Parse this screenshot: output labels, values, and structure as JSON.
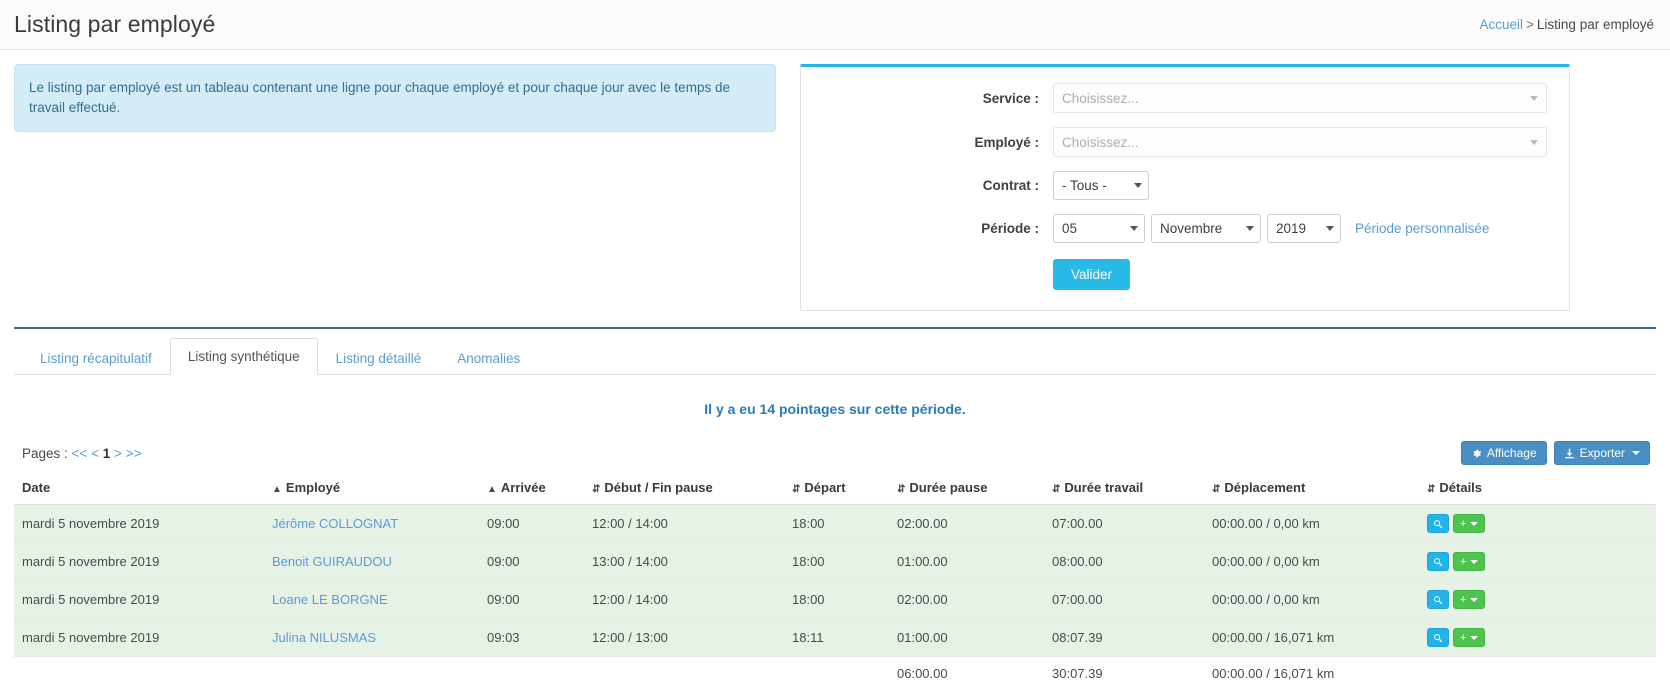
{
  "header": {
    "title": "Listing par employé",
    "breadcrumb_home": "Accueil",
    "breadcrumb_sep": ">",
    "breadcrumb_current": "Listing par employé"
  },
  "alert": {
    "text": "Le listing par employé est un tableau contenant une ligne pour chaque employé et pour chaque jour avec le temps de travail effectué."
  },
  "filters": {
    "service_label": "Service :",
    "service_placeholder": "Choisissez...",
    "service_value": "",
    "employe_label": "Employé :",
    "employe_placeholder": "Choisissez...",
    "employe_value": "",
    "contrat_label": "Contrat :",
    "contrat_value": "- Tous -",
    "periode_label": "Période :",
    "periode_day": "05",
    "periode_month": "Novembre",
    "periode_year": "2019",
    "periode_custom_link": "Période personnalisée",
    "submit_label": "Valider"
  },
  "tabs": [
    {
      "label": "Listing récapitulatif",
      "active": false
    },
    {
      "label": "Listing synthétique",
      "active": true
    },
    {
      "label": "Listing détaillé",
      "active": false
    },
    {
      "label": "Anomalies",
      "active": false
    }
  ],
  "summary": {
    "count_text": "Il y a eu 14 pointages sur cette période."
  },
  "toolbar": {
    "pages_label": "Pages :",
    "first": "<<",
    "prev": "<",
    "current": "1",
    "next": ">",
    "last": ">>",
    "affichage_label": "Affichage",
    "exporter_label": "Exporter",
    "gear_icon": "gear-icon",
    "download_icon": "download-icon"
  },
  "table": {
    "columns": [
      {
        "label": "Date",
        "sort": "none"
      },
      {
        "label": "Employé",
        "sort": "asc"
      },
      {
        "label": "Arrivée",
        "sort": "asc"
      },
      {
        "label": "Début / Fin pause",
        "sort": "both"
      },
      {
        "label": "Départ",
        "sort": "both"
      },
      {
        "label": "Durée pause",
        "sort": "both"
      },
      {
        "label": "Durée travail",
        "sort": "both"
      },
      {
        "label": "Déplacement",
        "sort": "both"
      },
      {
        "label": "Détails",
        "sort": "both"
      }
    ],
    "rows": [
      {
        "date": "mardi 5 novembre 2019",
        "employe": "Jérôme COLLOGNAT",
        "arrivee": "09:00",
        "pause": "12:00 / 14:00",
        "depart": "18:00",
        "duree_pause": "02:00.00",
        "duree_travail": "07:00.00",
        "deplacement": "00:00.00 / 0,00 km"
      },
      {
        "date": "mardi 5 novembre 2019",
        "employe": "Benoit GUIRAUDOU",
        "arrivee": "09:00",
        "pause": "13:00 / 14:00",
        "depart": "18:00",
        "duree_pause": "01:00.00",
        "duree_travail": "08:00.00",
        "deplacement": "00:00.00 / 0,00 km"
      },
      {
        "date": "mardi 5 novembre 2019",
        "employe": "Loane LE BORGNE",
        "arrivee": "09:00",
        "pause": "12:00 / 14:00",
        "depart": "18:00",
        "duree_pause": "02:00.00",
        "duree_travail": "07:00.00",
        "deplacement": "00:00.00 / 0,00 km"
      },
      {
        "date": "mardi 5 novembre 2019",
        "employe": "Julina NILUSMAS",
        "arrivee": "09:03",
        "pause": "12:00 / 13:00",
        "depart": "18:11",
        "duree_pause": "01:00.00",
        "duree_travail": "08:07.39",
        "deplacement": "00:00.00 / 16,071 km"
      }
    ],
    "totals": {
      "duree_pause": "06:00.00",
      "duree_travail": "30:07.39",
      "deplacement": "00:00.00 / 16,071 km"
    },
    "row_action_zoom_icon": "magnifier-icon",
    "row_action_add_label": "+"
  },
  "colors": {
    "accent": "#22b3e8",
    "link": "#5b9bd5",
    "row_bg": "#e7f2e7",
    "alert_bg": "#d4ecf5",
    "button_blue": "#4a8fc4",
    "button_green": "#4ec44e"
  }
}
